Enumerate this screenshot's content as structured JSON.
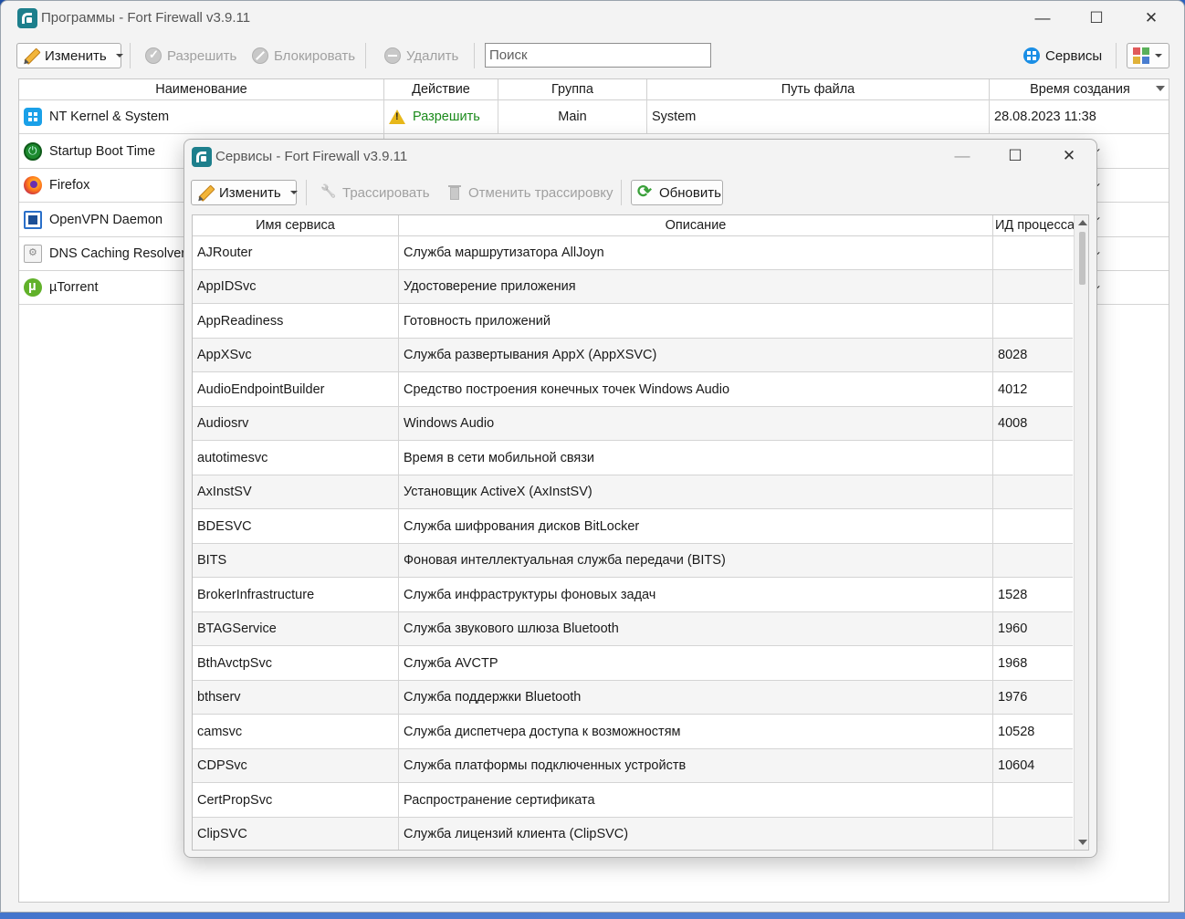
{
  "main_window": {
    "title": "Программы - Fort Firewall v3.9.11",
    "toolbar": {
      "edit_label": "Изменить",
      "allow_label": "Разрешить",
      "block_label": "Блокировать",
      "delete_label": "Удалить",
      "search_placeholder": "Поиск",
      "services_label": "Сервисы"
    },
    "columns": [
      "Наименование",
      "Действие",
      "Группа",
      "Путь файла",
      "Время создания"
    ],
    "programs": [
      {
        "name": "NT Kernel & System",
        "icon": "windows-logo-icon",
        "action": "Разрешить",
        "group": "Main",
        "path": "System",
        "created": "28.08.2023 11:38"
      },
      {
        "name": "Startup Boot Time",
        "icon": "power-icon"
      },
      {
        "name": "Firefox",
        "icon": "firefox-icon"
      },
      {
        "name": "OpenVPN Daemon",
        "icon": "openvpn-icon"
      },
      {
        "name": "DNS Caching Resolver",
        "icon": "dns-service-icon"
      },
      {
        "name": "µTorrent",
        "icon": "utorrent-icon"
      }
    ]
  },
  "services_window": {
    "title": "Сервисы - Fort Firewall v3.9.11",
    "toolbar": {
      "edit_label": "Изменить",
      "trace_label": "Трассировать",
      "untrace_label": "Отменить трассировку",
      "refresh_label": "Обновить"
    },
    "columns": [
      "Имя сервиса",
      "Описание",
      "ИД процесса"
    ],
    "services": [
      {
        "name": "AJRouter",
        "description": "Служба маршрутизатора AllJoyn",
        "pid": ""
      },
      {
        "name": "AppIDSvc",
        "description": "Удостоверение приложения",
        "pid": ""
      },
      {
        "name": "AppReadiness",
        "description": "Готовность приложений",
        "pid": ""
      },
      {
        "name": "AppXSvc",
        "description": "Служба развертывания AppX (AppXSVC)",
        "pid": "8028"
      },
      {
        "name": "AudioEndpointBuilder",
        "description": "Средство построения конечных точек Windows Audio",
        "pid": "4012"
      },
      {
        "name": "Audiosrv",
        "description": "Windows Audio",
        "pid": "4008"
      },
      {
        "name": "autotimesvc",
        "description": "Время в сети мобильной связи",
        "pid": ""
      },
      {
        "name": "AxInstSV",
        "description": "Установщик ActiveX (AxInstSV)",
        "pid": ""
      },
      {
        "name": "BDESVC",
        "description": "Служба шифрования дисков BitLocker",
        "pid": ""
      },
      {
        "name": "BITS",
        "description": "Фоновая интеллектуальная служба передачи (BITS)",
        "pid": ""
      },
      {
        "name": "BrokerInfrastructure",
        "description": "Служба инфраструктуры фоновых задач",
        "pid": "1528"
      },
      {
        "name": "BTAGService",
        "description": "Служба звукового шлюза Bluetooth",
        "pid": "1960"
      },
      {
        "name": "BthAvctpSvc",
        "description": "Служба AVCTP",
        "pid": "1968"
      },
      {
        "name": "bthserv",
        "description": "Служба поддержки Bluetooth",
        "pid": "1976"
      },
      {
        "name": "camsvc",
        "description": "Служба диспетчера доступа к возможностям",
        "pid": "10528"
      },
      {
        "name": "CDPSvc",
        "description": "Служба платформы подключенных устройств",
        "pid": "10604"
      },
      {
        "name": "CertPropSvc",
        "description": "Распространение сертификата",
        "pid": ""
      },
      {
        "name": "ClipSVC",
        "description": "Служба лицензий клиента (ClipSVC)",
        "pid": ""
      }
    ]
  }
}
